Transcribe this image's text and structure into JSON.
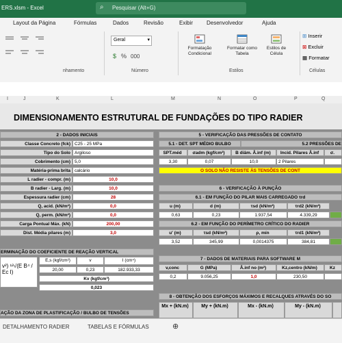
{
  "window": {
    "file_fragment": "ERS.xlsm - Excel",
    "search_placeholder": "Pesquisar (Alt+G)"
  },
  "menu": [
    "Layout da Página",
    "Fórmulas",
    "Dados",
    "Revisão",
    "Exibir",
    "Desenvolvedor",
    "Ajuda"
  ],
  "ribbon": {
    "group_alignment": "nhamento",
    "group_number": "Número",
    "group_styles": "Estilos",
    "group_cells": "Células",
    "number_format": "Geral",
    "cond_format": "Formatação Condicional",
    "format_table": "Formatar como Tabela",
    "cell_styles": "Estilos de Célula",
    "insert": "Inserir",
    "delete": "Excluir",
    "format": "Formatar"
  },
  "columns": [
    "I",
    "J",
    "K",
    "L",
    "M",
    "N",
    "O",
    "P",
    "Q"
  ],
  "sheet": {
    "title": "DIMENSIONAMENTO ESTRUTURAL DE FUNDAÇÕES DO TIPO RADIER",
    "s2": {
      "header": "2 - DADOS INICIAIS",
      "rows": [
        {
          "label": "Classe Concreto (fck)",
          "value": "C25 - 25 MPa"
        },
        {
          "label": "Tipo do Solo",
          "value": "Argiloso"
        },
        {
          "label": "Cobrimento (cm)",
          "value": "5,0"
        },
        {
          "label": "Matéria-prima brita",
          "value": "calcário"
        },
        {
          "label": "L radier - compr. (m)",
          "value": "10,0"
        },
        {
          "label": "B radier - Larg. (m)",
          "value": "10,0"
        },
        {
          "label": "Espessura radier (cm)",
          "value": "28"
        },
        {
          "label": "Q, acid. (kN/m²)",
          "value": "0,0"
        },
        {
          "label": "Q, perm. (kN/m²)",
          "value": "0,0"
        },
        {
          "label": "Carga Pontual Máx. (kN)",
          "value": "200,00"
        },
        {
          "label": "Dist. Média pilares (m)",
          "value": "3,0"
        }
      ]
    },
    "s3": {
      "header": "ERMINAÇÃO DO COEFICIENTE DE REAÇÃO VERTICAL",
      "cols": [
        "E,s (kgf/cm²)",
        "v",
        "I (cm⁴)"
      ],
      "vals": [
        "20,00",
        "0,23",
        "182.933,33"
      ],
      "kv_label": "Kv (kgf/cm³)",
      "kv_value": "0,023",
      "formula": "v²) ¹²√(E B⁴ / Ec I)"
    },
    "s_bottom_left": "AÇÃO DA ZONA DE PLASTIFICAÇÃO / BULBO DE TENSÕES",
    "s5": {
      "header": "5 - VERIFICAÇÃO DAS PRESSÕES DE CONTATO",
      "sub1": "5.1 - DET. SPT MÉDIO BULBO",
      "sub2": "5.2 PRESSÕES DE",
      "cols": [
        "SPT.méd",
        "σadm (kgf/cm²)",
        "B diâm. Â.inf (m)",
        "Incid. Pilares Â.inf",
        "σ."
      ],
      "vals": [
        "3,30",
        "0,07",
        "10,0",
        "2 Pilares"
      ],
      "warning": "O SOLO NÃO RESISTE ÀS TENSÕES DE CONT"
    },
    "s6": {
      "header": "6 - VERIFICAÇÃO À PUNÇÃO",
      "sub1": "6.1 - EM FUNÇÃO DO PILAR MAIS CARREGADO τrd",
      "cols1": [
        "u (m)",
        "d (m)",
        "τsd (kN/m²)",
        "τrd2 (kN/m²)"
      ],
      "vals1": [
        "0,63",
        "0,23",
        "1.937,54",
        "4.339,29"
      ],
      "sub2": "6.2 - EM FUNÇÃO DO PERÍMETRO CRÍTICO DO RADIER",
      "cols2": [
        "u' (m)",
        "τsd (kN/m²)",
        "ρ, mín",
        "τrd1 (kN/m²)"
      ],
      "vals2": [
        "3,52",
        "345,99",
        "0,0014375",
        "384,81"
      ]
    },
    "s7": {
      "header": "7 - DADOS DE MATERIAIS PARA SOFTWARE M",
      "cols": [
        "v,conc",
        "G (MPa)",
        "Â.inf no (m²)",
        "Kz,centro (kN/m)",
        "Kz"
      ],
      "vals": [
        "0,2",
        "9.056,25",
        "1,0",
        "230,50"
      ]
    },
    "s8": {
      "header": "8 - OBTENÇÃO DOS ESFORÇOS MÁXIMOS E RECALQUES ATRAVÉS DO SO",
      "cols": [
        "Mx + (kN.m)",
        "My + (kN.m)",
        "Mx - (kN.m)",
        "My - (kN.m)"
      ]
    }
  },
  "tabs": [
    "DETALHAMENTO RADIER",
    "TABELAS E FÓRMULAS"
  ],
  "colors": {
    "excel_green": "#217346",
    "warning_yellow": "#ffff00",
    "value_red": "#c00000",
    "ok_green": "#70ad47"
  }
}
